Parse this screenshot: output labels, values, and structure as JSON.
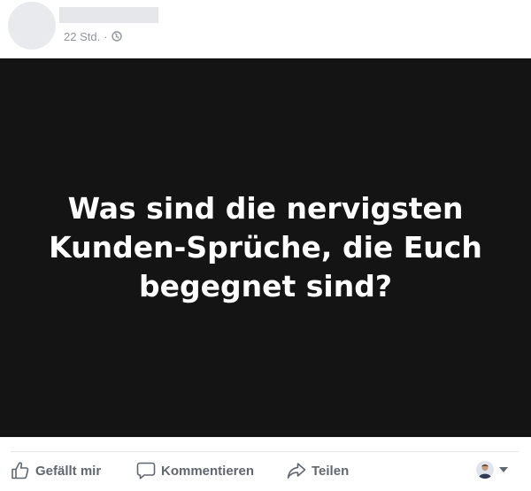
{
  "post": {
    "timestamp": "22 Std.",
    "separator": "·",
    "privacy_icon": "globe-icon",
    "image_text": "Was sind die nervigsten Kunden-Sprüche, die Euch begegnet sind?"
  },
  "actions": {
    "like_label": "Gefällt mir",
    "comment_label": "Kommentieren",
    "share_label": "Teilen",
    "like_icon": "thumbs-up-icon",
    "comment_icon": "speech-bubble-icon",
    "share_icon": "share-arrow-icon"
  },
  "colors": {
    "image_background": "#141414",
    "action_text": "#606770",
    "meta_text": "#90949c"
  }
}
